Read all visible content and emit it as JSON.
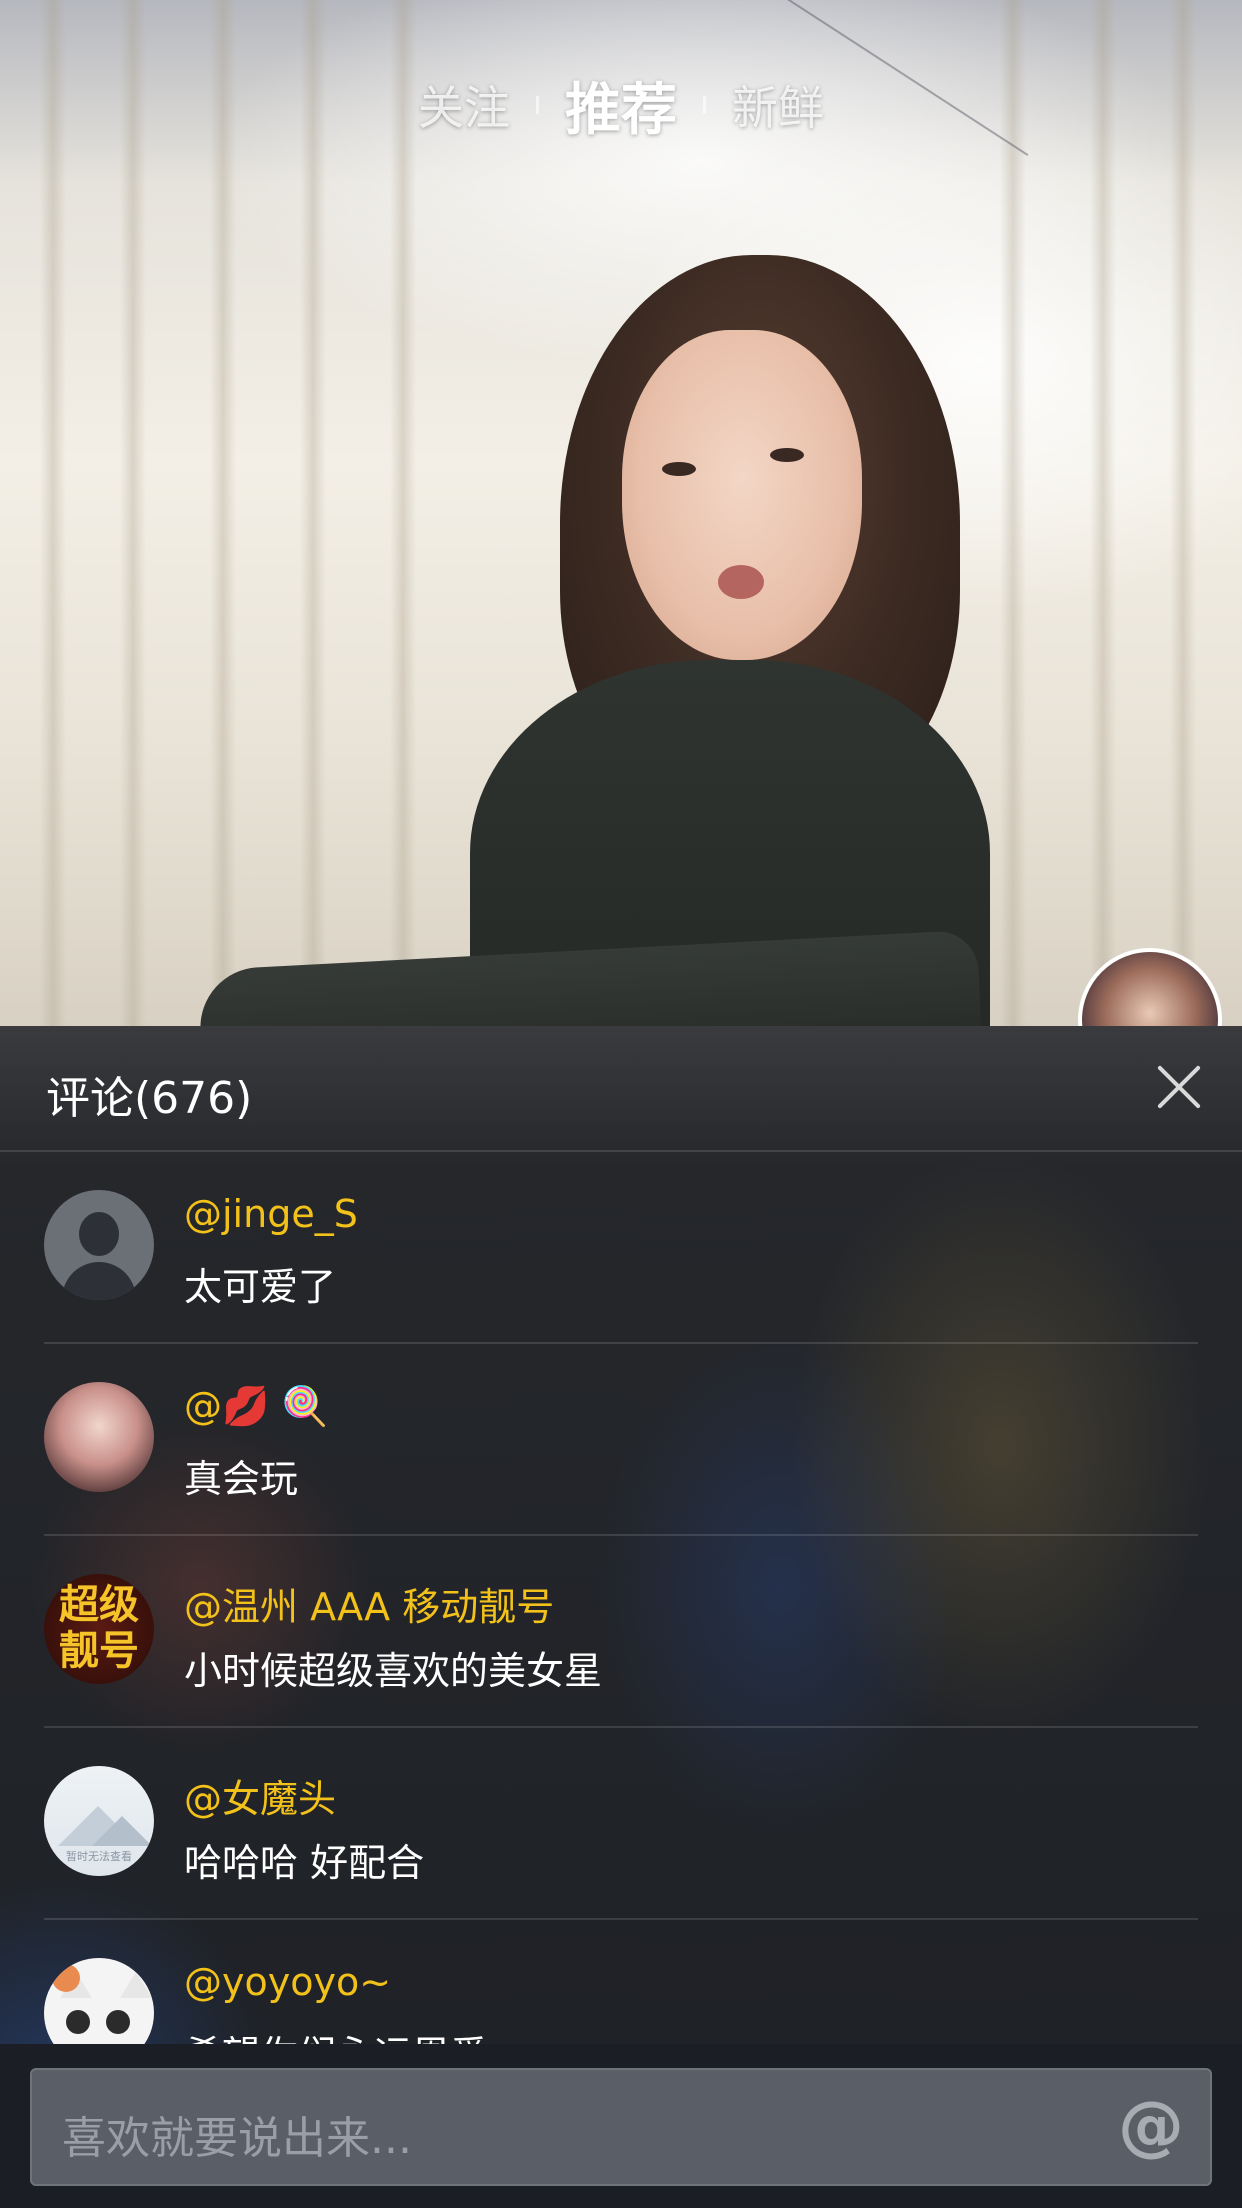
{
  "top_tabs": {
    "follow": "关注",
    "recommend": "推荐",
    "fresh": "新鲜"
  },
  "comments_panel": {
    "title": "评论(676)",
    "comments": [
      {
        "username": "@jinge_S",
        "text": "太可爱了",
        "avatar": "default-person-icon"
      },
      {
        "username": "@💋 🍭",
        "text": "真会玩",
        "avatar": "girl-photo"
      },
      {
        "username": "@温州 AAA 移动靓号",
        "text": "小时候超级喜欢的美女星",
        "avatar": "super-number-logo",
        "avatar_text": [
          "超级",
          "靓号"
        ]
      },
      {
        "username": "@女魔头",
        "text": "哈哈哈 好配合",
        "avatar": "broken-image-icon",
        "avatar_caption": "暂时无法查看"
      },
      {
        "username": "@yoyoyo~",
        "text": "希望你们永远恩爱",
        "avatar": "cat-cartoon"
      }
    ]
  },
  "input": {
    "placeholder": "喜欢就要说出来...",
    "at_symbol": "@"
  },
  "colors": {
    "username": "#f2c11a",
    "panel_bg": "#1e2126",
    "input_bg": "#5a5e66"
  }
}
